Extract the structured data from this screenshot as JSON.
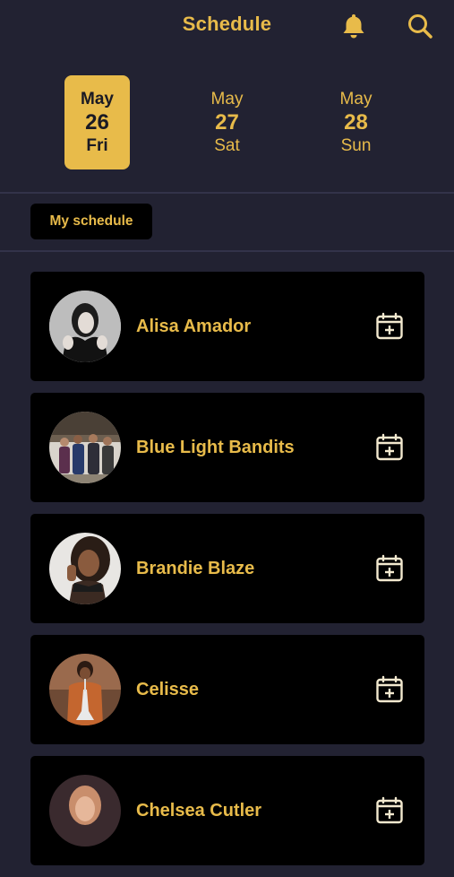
{
  "header": {
    "title": "Schedule",
    "bell_icon": "bell-icon",
    "search_icon": "search-icon"
  },
  "days": [
    {
      "month": "May",
      "day": "26",
      "weekday": "Fri",
      "selected": true
    },
    {
      "month": "May",
      "day": "27",
      "weekday": "Sat",
      "selected": false
    },
    {
      "month": "May",
      "day": "28",
      "weekday": "Sun",
      "selected": false
    }
  ],
  "filter": {
    "my_schedule_label": "My schedule"
  },
  "artists": [
    {
      "name": "Alisa Amador",
      "action_icon": "calendar-plus-icon"
    },
    {
      "name": "Blue Light Bandits",
      "action_icon": "calendar-plus-icon"
    },
    {
      "name": "Brandie Blaze",
      "action_icon": "calendar-plus-icon"
    },
    {
      "name": "Celisse",
      "action_icon": "calendar-plus-icon"
    },
    {
      "name": "Chelsea Cutler",
      "action_icon": "calendar-plus-icon"
    }
  ],
  "colors": {
    "accent": "#e8bb4a",
    "background": "#222232",
    "card": "#000000",
    "icon_cream": "#f3e9cf"
  }
}
